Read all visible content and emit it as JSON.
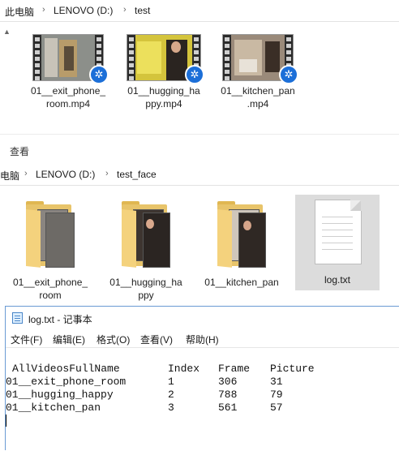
{
  "explorer_top": {
    "breadcrumb": [
      "此电脑",
      "LENOVO (D:)",
      "test"
    ],
    "files": [
      {
        "name": "01__exit_phone_room.mp4",
        "line1": "01__exit_phone_",
        "line2": "room.mp4"
      },
      {
        "name": "01__hugging_happy.mp4",
        "line1": "01__hugging_ha",
        "line2": "ppy.mp4"
      },
      {
        "name": "01__kitchen_pan.mp4",
        "line1": "01__kitchen_pan",
        "line2": ".mp4"
      }
    ]
  },
  "ribbon": {
    "view_tab": "查看"
  },
  "explorer_bottom": {
    "breadcrumb": [
      "电脑",
      "LENOVO (D:)",
      "test_face"
    ],
    "folders": [
      {
        "line1": "01__exit_phone_",
        "line2": "room"
      },
      {
        "line1": "01__hugging_ha",
        "line2": "ppy"
      },
      {
        "line1": "01__kitchen_pan",
        "line2": ""
      }
    ],
    "log_file": "log.txt"
  },
  "notepad": {
    "title": "log.txt - 记事本",
    "menu": [
      "文件(F)",
      "编辑(E)",
      "格式(O)",
      "查看(V)",
      "帮助(H)"
    ],
    "columns": [
      "AllVideosFullName",
      "Index",
      "Frame",
      "Picture"
    ],
    "rows": [
      [
        "01__exit_phone_room",
        "1",
        "306",
        "31"
      ],
      [
        "01__hugging_happy",
        "2",
        "788",
        "79"
      ],
      [
        "01__kitchen_pan",
        "3",
        "561",
        "57"
      ]
    ]
  },
  "colors": {
    "selection": "#dcdcdc",
    "qq_badge": "#1c6fd8",
    "folder": "#e8c46a",
    "notepad_border": "#6a9bd4"
  },
  "icons": [
    "chevron-right-icon",
    "chevron-up-icon",
    "video-file-icon",
    "qq-badge-icon",
    "folder-icon",
    "text-file-icon",
    "notepad-icon"
  ]
}
